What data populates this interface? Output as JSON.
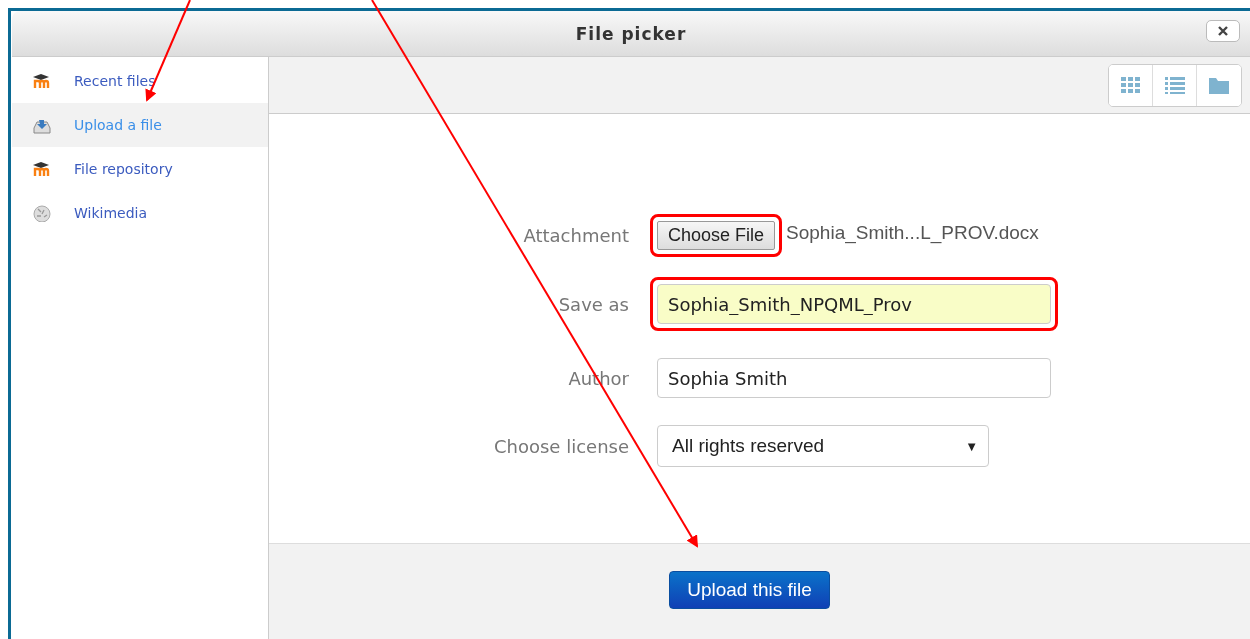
{
  "window": {
    "title": "File picker"
  },
  "sidebar": {
    "items": [
      {
        "label": "Recent files",
        "kind": "moodle",
        "selected": false
      },
      {
        "label": "Upload a file",
        "kind": "upload",
        "selected": true
      },
      {
        "label": "File repository",
        "kind": "moodle",
        "selected": false
      },
      {
        "label": "Wikimedia",
        "kind": "wiki",
        "selected": false
      }
    ]
  },
  "form": {
    "fields": [
      {
        "label": "Attachment",
        "kind": "file",
        "button": "Choose File",
        "value": "Sophia_Smith...L_PROV.docx",
        "highlighted": true
      },
      {
        "label": "Save as",
        "kind": "text",
        "value": "Sophia_Smith_NPQML_Prov",
        "highlighted": true,
        "autofilled": true
      },
      {
        "label": "Author",
        "kind": "text",
        "value": "Sophia Smith",
        "highlighted": false,
        "autofilled": false
      },
      {
        "label": "Choose license",
        "kind": "select",
        "value": "All rights reserved",
        "caret": "▼",
        "highlighted": false
      }
    ]
  },
  "footer": {
    "button": "Upload this file"
  }
}
